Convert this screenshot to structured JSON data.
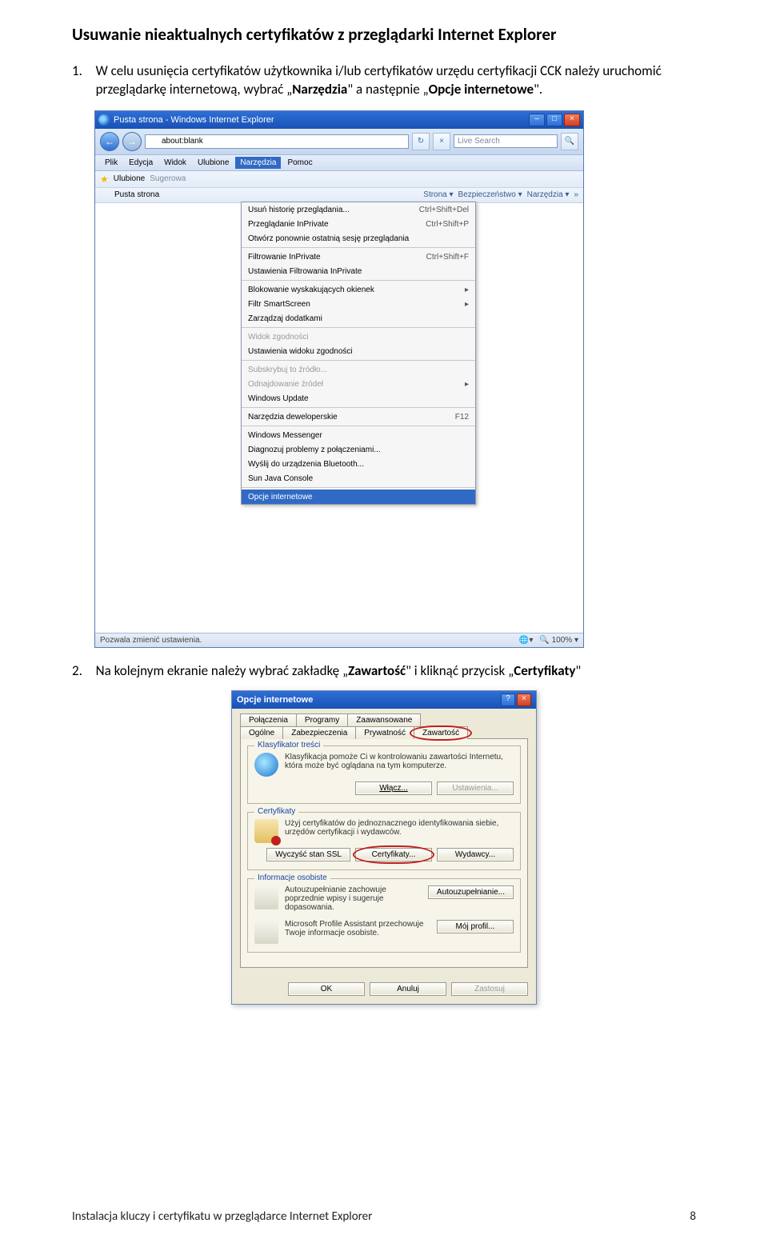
{
  "heading": "Usuwanie nieaktualnych certyfikatów z przeglądarki Internet Explorer",
  "step1": {
    "num": "1.",
    "pre": "W celu usunięcia certyfikatów użytkownika i/lub certyfikatów urzędu certyfikacji CCK należy uruchomić przeglądarkę internetową, wybrać „",
    "b1": "Narzędzia",
    "mid": "\" a następnie „",
    "b2": "Opcje internetowe",
    "post": "\"."
  },
  "step2": {
    "num": "2.",
    "pre": "Na kolejnym ekranie należy wybrać zakładkę „",
    "b1": "Zawartość",
    "mid": "\" i kliknąć przycisk „",
    "b2": "Certyfikaty",
    "post": "\""
  },
  "ie": {
    "title": "Pusta strona - Windows Internet Explorer",
    "address": "about:blank",
    "search_placeholder": "Live Search",
    "menubar": [
      "Plik",
      "Edycja",
      "Widok",
      "Ulubione",
      "Narzędzia",
      "Pomoc"
    ],
    "favbar_btn": "Ulubione",
    "favbar_sugg": "Sugerowa",
    "tab": "Pusta strona",
    "toolbar_right": [
      "Strona ▾",
      "Bezpieczeństwo ▾",
      "Narzędzia ▾"
    ],
    "status": "Pozwala zmienić ustawienia.",
    "zoom": "100%",
    "menu": {
      "g1": [
        {
          "label": "Usuń historię przeglądania...",
          "kbd": "Ctrl+Shift+Del"
        },
        {
          "label": "Przeglądanie InPrivate",
          "kbd": "Ctrl+Shift+P"
        },
        {
          "label": "Otwórz ponownie ostatnią sesję przeglądania",
          "kbd": ""
        }
      ],
      "g2": [
        {
          "label": "Filtrowanie InPrivate",
          "kbd": "Ctrl+Shift+F"
        },
        {
          "label": "Ustawienia Filtrowania InPrivate",
          "kbd": ""
        }
      ],
      "g3": [
        {
          "label": "Blokowanie wyskakujących okienek",
          "arrow": true
        },
        {
          "label": "Filtr SmartScreen",
          "arrow": true
        },
        {
          "label": "Zarządzaj dodatkami"
        }
      ],
      "g4": [
        {
          "label": "Widok zgodności",
          "disabled": true
        },
        {
          "label": "Ustawienia widoku zgodności"
        }
      ],
      "g5": [
        {
          "label": "Subskrybuj to źródło...",
          "disabled": true
        },
        {
          "label": "Odnajdowanie źródeł",
          "disabled": true,
          "arrow": true
        },
        {
          "label": "Windows Update"
        }
      ],
      "g6": [
        {
          "label": "Narzędzia deweloperskie",
          "kbd": "F12"
        }
      ],
      "g7": [
        {
          "label": "Windows Messenger"
        },
        {
          "label": "Diagnozuj problemy z połączeniami..."
        },
        {
          "label": "Wyślij do urządzenia Bluetooth..."
        },
        {
          "label": "Sun Java Console"
        }
      ],
      "hl": "Opcje internetowe"
    }
  },
  "dlg": {
    "title": "Opcje internetowe",
    "tabs_row1": [
      "Połączenia",
      "Programy",
      "Zaawansowane"
    ],
    "tabs_row2": [
      "Ogólne",
      "Zabezpieczenia",
      "Prywatność",
      "Zawartość"
    ],
    "g_klas": {
      "legend": "Klasyfikator treści",
      "text": "Klasyfikacja pomoże Ci w kontrolowaniu zawartości Internetu, która może być oglądana na tym komputerze.",
      "b1": "Włącz...",
      "b2": "Ustawienia..."
    },
    "g_cert": {
      "legend": "Certyfikaty",
      "text": "Użyj certyfikatów do jednoznacznego identyfikowania siebie, urzędów certyfikacji i wydawców.",
      "b1": "Wyczyść stan SSL",
      "b2": "Certyfikaty...",
      "b3": "Wydawcy..."
    },
    "g_info": {
      "legend": "Informacje osobiste",
      "t1": "Autouzupełnianie zachowuje poprzednie wpisy i sugeruje dopasowania.",
      "b1": "Autouzupełnianie...",
      "t2": "Microsoft Profile Assistant przechowuje Twoje informacje osobiste.",
      "b2": "Mój profil..."
    },
    "ok": "OK",
    "cancel": "Anuluj",
    "apply": "Zastosuj"
  },
  "footer": {
    "left": "Instalacja kluczy i certyfikatu w przeglądarce Internet Explorer",
    "right": "8"
  }
}
